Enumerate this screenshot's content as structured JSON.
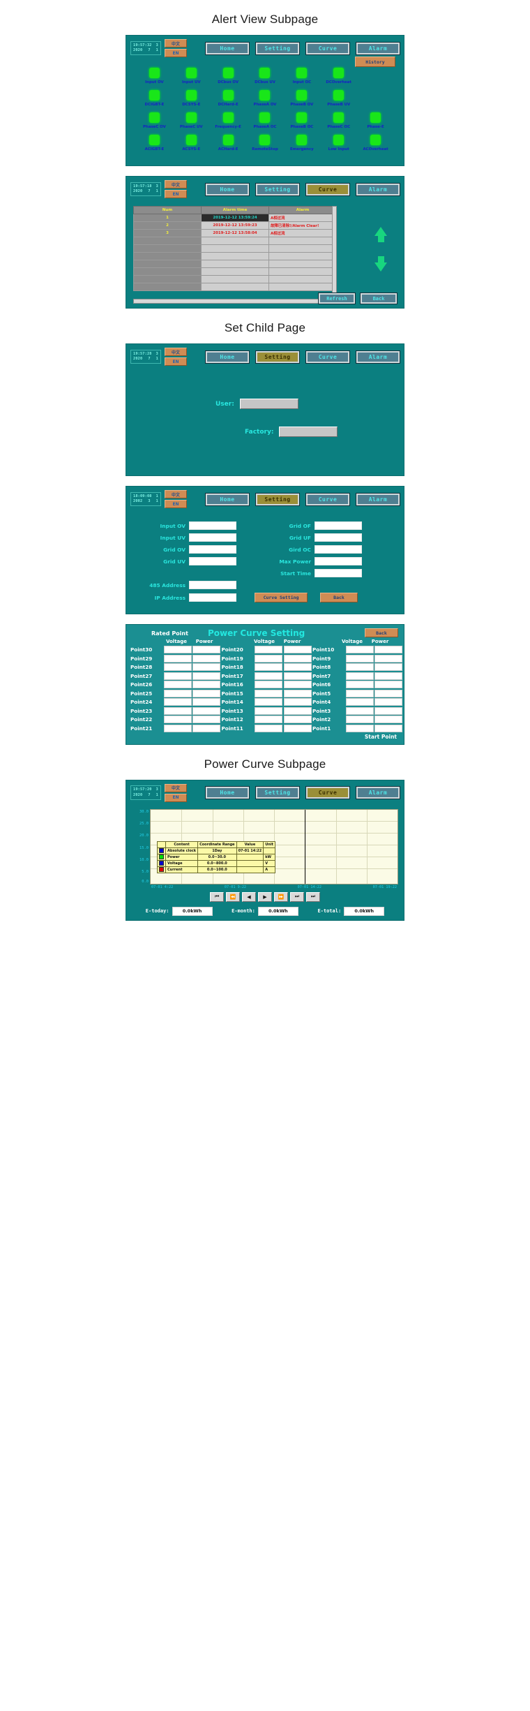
{
  "sections": {
    "alert_view": "Alert View Subpage",
    "set_child": "Set Child Page",
    "power_curve": "Power Curve Subpage"
  },
  "header": {
    "clock1": {
      "time": "19:57:32",
      "weekday": "3",
      "year": "2020",
      "month": "7",
      "day": "1"
    },
    "clock2": {
      "time": "19:57:28",
      "weekday": "3",
      "year": "2020",
      "month": "7",
      "day": "1"
    },
    "clock3": {
      "time": "19:57:18",
      "weekday": "3",
      "year": "2020",
      "month": "7",
      "day": "1"
    },
    "clock4": {
      "time": "18:09:08",
      "weekday": "1",
      "year": "2002",
      "month": "3",
      "day": "1"
    },
    "clock5": {
      "time": "19:57:20",
      "weekday": "3",
      "year": "2020",
      "month": "7",
      "day": "1"
    },
    "lang_cn": "中文",
    "lang_en": "EN",
    "nav": {
      "home": "Home",
      "setting": "Setting",
      "curve": "Curve",
      "alarm": "Alarm"
    },
    "history": "History"
  },
  "leds": {
    "rows": [
      [
        "Input OV",
        "Input UV",
        "DCbus OV",
        "DCbus UV",
        "Input OC",
        "DCOverheat",
        ""
      ],
      [
        "DCIGBT-E",
        "DCSYS-E",
        "DCHard-E",
        "PhaseA OV",
        "PhaseB OV",
        "PhaseB UV",
        ""
      ],
      [
        "PhaseC OV",
        "PhaseC UV",
        "Frequency-E",
        "PhaseA OC",
        "PhaseB OC",
        "PhaseC OC",
        "Phase-E"
      ],
      [
        "ACIGBT-E",
        "ACSYS-E",
        "ACHard-E",
        "RemoteStop",
        "Emergency",
        "Low Input",
        "ACOverheat"
      ]
    ],
    "color": "#19e619"
  },
  "alarm_table": {
    "columns": [
      "Num",
      "Alarm time",
      "Alarm"
    ],
    "rows": [
      {
        "num": "1",
        "time": "2019-12-12 13:59:24",
        "alarm": "A相过流"
      },
      {
        "num": "2",
        "time": "2019-12-12 13:59:23",
        "alarm": "故障已清除!/Alarm Clear!"
      },
      {
        "num": "3",
        "time": "2019-12-12 13:58:04",
        "alarm": "A相过流"
      }
    ],
    "empty_rows": 7,
    "refresh": "Refresh",
    "back": "Back"
  },
  "set_child": {
    "user_label": "User:",
    "user_value": "",
    "factory_label": "Factory:",
    "factory_value": ""
  },
  "params": {
    "left": [
      {
        "label": "Input OV",
        "value": ""
      },
      {
        "label": "Input UV",
        "value": ""
      },
      {
        "label": "Grid OV",
        "value": ""
      },
      {
        "label": "Grid UV",
        "value": ""
      }
    ],
    "right": [
      {
        "label": "Grid OF",
        "value": ""
      },
      {
        "label": "Grid UF",
        "value": ""
      },
      {
        "label": "Gird OC",
        "value": ""
      },
      {
        "label": "Max Power",
        "value": ""
      },
      {
        "label": "Start Time",
        "value": ""
      }
    ],
    "addr": [
      {
        "label": "485 Address",
        "value": ""
      },
      {
        "label": "IP Address",
        "value": ""
      }
    ],
    "curve_setting": "Curve Setting",
    "back": "Back"
  },
  "power_curve_setting": {
    "rated_point": "Rated Point",
    "title": "Power Curve Setting",
    "back": "Back",
    "sub_headers": [
      "Voltage",
      "Power"
    ],
    "start_point": "Start Point",
    "rows": [
      [
        "Point30",
        "Point20",
        "Point10"
      ],
      [
        "Point29",
        "Point19",
        "Point9"
      ],
      [
        "Point28",
        "Point18",
        "Point8"
      ],
      [
        "Point27",
        "Point17",
        "Point7"
      ],
      [
        "Point26",
        "Point16",
        "Point6"
      ],
      [
        "Point25",
        "Point15",
        "Point5"
      ],
      [
        "Point24",
        "Point14",
        "Point4"
      ],
      [
        "Point23",
        "Point13",
        "Point3"
      ],
      [
        "Point22",
        "Point12",
        "Point2"
      ],
      [
        "Point21",
        "Point11",
        "Point1"
      ]
    ]
  },
  "chart_data": {
    "type": "line",
    "title": "",
    "ylabel": "",
    "xlabel": "",
    "ylim": [
      0,
      30
    ],
    "yticks": [
      "30.0",
      "25.0",
      "20.0",
      "15.0",
      "10.0",
      "5.0",
      "0.0"
    ],
    "xticks": [
      "07-01 4:22",
      "07-01 9:22",
      "07-01 14:22",
      "07-01 19:22"
    ],
    "grid": true,
    "legend_position": "overlay",
    "columns": [
      "Content",
      "Coordinate Range",
      "Value",
      "Unit"
    ],
    "series": [
      {
        "name": "Absolute clock",
        "color": "#0000cc",
        "range": "1Day",
        "value": "07-01 14:22",
        "unit": ""
      },
      {
        "name": "Power",
        "color": "#00dd00",
        "range": "0.0~30.0",
        "value": "",
        "unit": "kW"
      },
      {
        "name": "Voltage",
        "color": "#0000cc",
        "range": "0.0~800.0",
        "value": "",
        "unit": "V"
      },
      {
        "name": "Current",
        "color": "#dd0000",
        "range": "0.0~100.0",
        "value": "",
        "unit": "A"
      }
    ]
  },
  "chart_controls": [
    "⏮",
    "⏪",
    "◀",
    "▶",
    "⏩",
    "⏭",
    "⏭"
  ],
  "totals": [
    {
      "label": "E-today:",
      "value": "0.0kWh"
    },
    {
      "label": "E-month:",
      "value": "0.0kWh"
    },
    {
      "label": "E-total:",
      "value": "0.0kWh"
    }
  ]
}
